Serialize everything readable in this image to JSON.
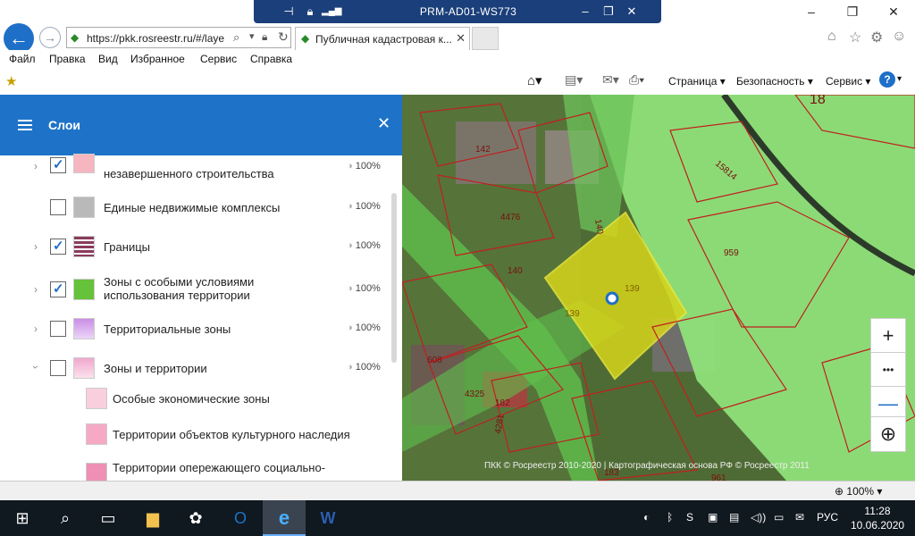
{
  "window": {
    "rdp_title": "PRM-AD01-WS773"
  },
  "browser": {
    "url": "https://pkk.rosreestr.ru/#/laye",
    "tab_title": "Публичная кадастровая к..."
  },
  "menu": [
    "Файл",
    "Правка",
    "Вид",
    "Избранное",
    "Сервис",
    "Справка"
  ],
  "commandbar": {
    "page": "Страница ▾",
    "security": "Безопасность ▾",
    "service": "Сервис ▾"
  },
  "panel": {
    "title": "Слои",
    "layers": [
      {
        "label": "незавершенного строительства",
        "checked": true,
        "opacity": "100%",
        "color": "#f6b6bf"
      },
      {
        "label": "Единые недвижимые комплексы",
        "checked": false,
        "opacity": "100%",
        "color": "#b9b9b9"
      },
      {
        "label": "Границы",
        "checked": true,
        "opacity": "100%",
        "color": "#8a3c5c"
      },
      {
        "label": "Зоны с особыми условиями\nиспользования территории",
        "checked": true,
        "opacity": "100%",
        "color": "#66c23a"
      },
      {
        "label": "Территориальные зоны",
        "checked": false,
        "opacity": "100%",
        "color": "#c98ee6"
      },
      {
        "label": "Зоны и территории",
        "checked": false,
        "opacity": "100%",
        "color": "#f0a8cc"
      }
    ],
    "sublayers": [
      {
        "label": "Особые экономические зоны",
        "color": "#f9cfdd"
      },
      {
        "label": "Территории объектов культурного наследия",
        "color": "#f6a9c4"
      },
      {
        "label": "Территории опережающего социально-",
        "color": "#ef8fb6"
      }
    ]
  },
  "map": {
    "labels": [
      "142",
      "15814",
      "18",
      "4476",
      "140",
      "959",
      "140",
      "139",
      "139",
      "608",
      "4325",
      "182",
      "4281",
      "183",
      "961"
    ],
    "copyright": "ПКК © Росреестр 2010-2020 | Картографическая основа РФ © Росреестр 2011",
    "buttons": {
      "zoom_in": "+",
      "more": "•••",
      "zoom_out": "—"
    }
  },
  "statusbar": {
    "zoom": "100%"
  },
  "taskbar": {
    "lang": "РУС",
    "time": "11:28",
    "date": "10.06.2020"
  }
}
